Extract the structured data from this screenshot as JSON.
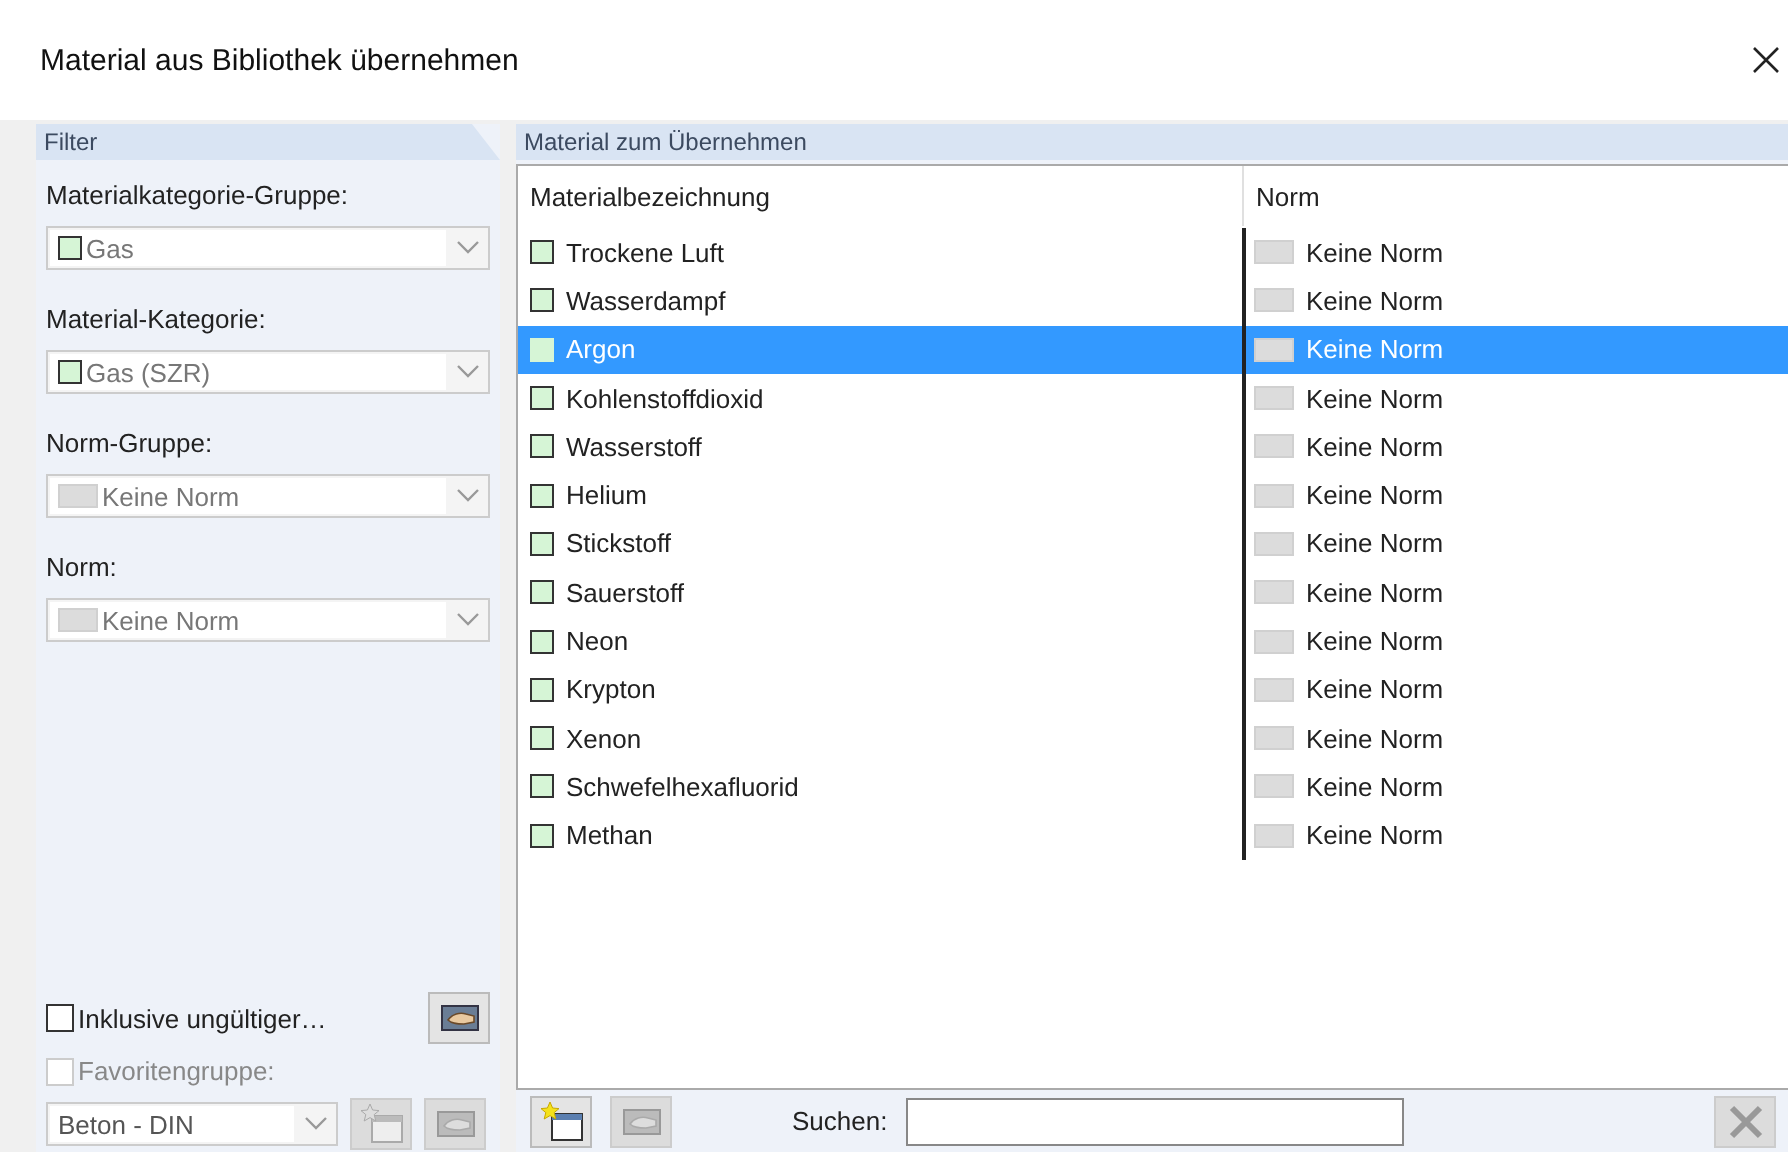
{
  "window": {
    "title": "Material aus Bibliothek übernehmen"
  },
  "filter": {
    "title": "Filter",
    "fields": [
      {
        "label": "Materialkategorie-Gruppe:",
        "value": "Gas",
        "kind": "material",
        "disabled": true
      },
      {
        "label": "Material-Kategorie:",
        "value": "Gas (SZR)",
        "kind": "material",
        "disabled": true
      },
      {
        "label": "Norm-Gruppe:",
        "value": "Keine Norm",
        "kind": "norm",
        "disabled": true
      },
      {
        "label": "Norm:",
        "value": "Keine Norm",
        "kind": "norm",
        "disabled": true
      }
    ],
    "include_invalid": {
      "label": "Inklusive ungültiger…",
      "checked": false
    },
    "favorites": {
      "label": "Favoritengruppe:",
      "checked": false,
      "disabled": true,
      "value": "Beton - DIN"
    }
  },
  "materials": {
    "title": "Material zum Übernehmen",
    "columns": [
      "Materialbezeichnung",
      "Norm"
    ],
    "rows": [
      {
        "name": "Trockene Luft",
        "norm": "Keine Norm",
        "selected": false
      },
      {
        "name": "Wasserdampf",
        "norm": "Keine Norm",
        "selected": false
      },
      {
        "name": "Argon",
        "norm": "Keine Norm",
        "selected": true
      },
      {
        "name": "Kohlenstoffdioxid",
        "norm": "Keine Norm",
        "selected": false
      },
      {
        "name": "Wasserstoff",
        "norm": "Keine Norm",
        "selected": false
      },
      {
        "name": "Helium",
        "norm": "Keine Norm",
        "selected": false
      },
      {
        "name": "Stickstoff",
        "norm": "Keine Norm",
        "selected": false
      },
      {
        "name": "Sauerstoff",
        "norm": "Keine Norm",
        "selected": false
      },
      {
        "name": "Neon",
        "norm": "Keine Norm",
        "selected": false
      },
      {
        "name": "Krypton",
        "norm": "Keine Norm",
        "selected": false
      },
      {
        "name": "Xenon",
        "norm": "Keine Norm",
        "selected": false
      },
      {
        "name": "Schwefelhexafluorid",
        "norm": "Keine Norm",
        "selected": false
      },
      {
        "name": "Methan",
        "norm": "Keine Norm",
        "selected": false
      }
    ]
  },
  "search": {
    "label": "Suchen:"
  }
}
